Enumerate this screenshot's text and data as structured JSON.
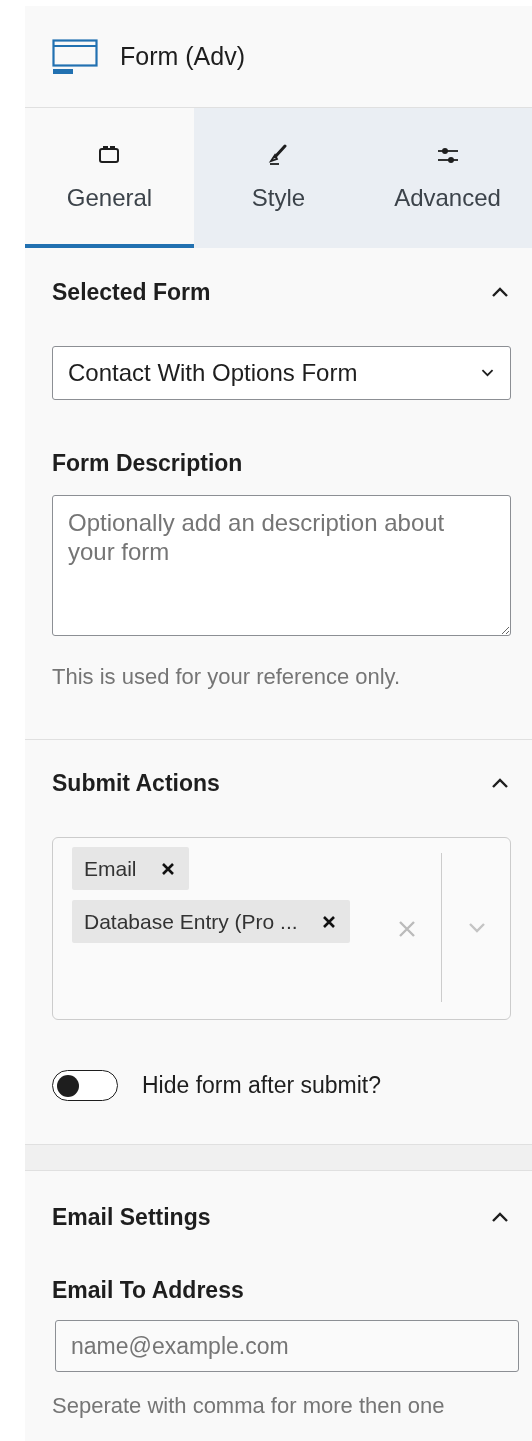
{
  "panel": {
    "title": "Form (Adv)"
  },
  "tabs": [
    {
      "label": "General",
      "kind": "general",
      "selected": true
    },
    {
      "label": "Style",
      "kind": "style",
      "selected": false
    },
    {
      "label": "Advanced",
      "kind": "advanced",
      "selected": false
    }
  ],
  "selected_form_section": {
    "title": "Selected Form",
    "expanded": true,
    "select": {
      "value": "Contact With Options Form"
    },
    "description": {
      "label": "Form Description",
      "placeholder": "Optionally add an description about your form"
    },
    "help": "This is used for your reference only."
  },
  "submit_actions_section": {
    "title": "Submit Actions",
    "expanded": true,
    "tokens": [
      {
        "label": "Email"
      },
      {
        "label": "Database Entry (Pro ..."
      }
    ],
    "hide_form_toggle": {
      "label": "Hide form after submit?",
      "on": false
    }
  },
  "email_settings_section": {
    "title": "Email Settings",
    "expanded": true,
    "email_to": {
      "label": "Email To Address",
      "placeholder": "name@example.com"
    },
    "help": "Seperate with comma for more then one"
  }
}
